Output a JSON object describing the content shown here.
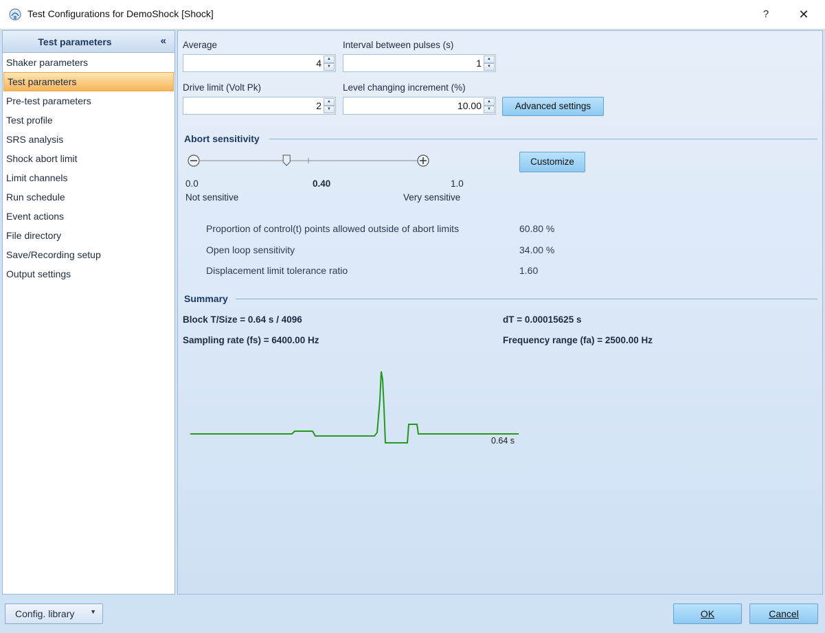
{
  "window": {
    "title": "Test Configurations for DemoShock [Shock]",
    "help_label": "?",
    "close_label": "✕"
  },
  "sidebar": {
    "header": "Test parameters",
    "collapse_label": "«",
    "items": [
      {
        "label": "Shaker parameters"
      },
      {
        "label": "Test parameters"
      },
      {
        "label": "Pre-test parameters"
      },
      {
        "label": "Test profile"
      },
      {
        "label": "SRS analysis"
      },
      {
        "label": "Shock abort limit"
      },
      {
        "label": "Limit channels"
      },
      {
        "label": "Run schedule"
      },
      {
        "label": "Event actions"
      },
      {
        "label": "File directory"
      },
      {
        "label": "Save/Recording setup"
      },
      {
        "label": "Output settings"
      }
    ],
    "selected_index": 1
  },
  "params": {
    "average": {
      "label": "Average",
      "value": "4"
    },
    "interval": {
      "label": "Interval between pulses (s)",
      "value": "1"
    },
    "drive_limit": {
      "label": "Drive limit (Volt Pk)",
      "value": "2"
    },
    "level_increment": {
      "label": "Level changing increment (%)",
      "value": "10.00"
    },
    "advanced_label": "Advanced settings"
  },
  "abort": {
    "section_title": "Abort sensitivity",
    "customize_label": "Customize",
    "slider_value": 0.4,
    "min_value": "0.0",
    "max_value": "1.0",
    "current_label": "0.40",
    "min_caption": "Not sensitive",
    "max_caption": "Very sensitive",
    "info": [
      {
        "label": "Proportion of control(t) points allowed outside of abort limits",
        "value": "60.80 %"
      },
      {
        "label": "Open loop sensitivity",
        "value": "34.00 %"
      },
      {
        "label": "Displacement limit tolerance ratio",
        "value": "1.60"
      }
    ]
  },
  "summary": {
    "section_title": "Summary",
    "block": "Block T/Size = 0.64 s / 4096",
    "dt": "dT = 0.00015625 s",
    "sampling": "Sampling rate (fs) = 6400.00 Hz",
    "freq_range": "Frequency range (fa) = 2500.00 Hz",
    "waveform_end_label": "0.64 s",
    "waveform_color": "#1f9a1f"
  },
  "footer": {
    "config_library_label": "Config. library",
    "ok_label": "OK",
    "cancel_label": "Cancel"
  },
  "colors": {
    "selected_item": "#f7b45a",
    "button": "#8fcaf2",
    "section_title": "#1e3a63"
  }
}
